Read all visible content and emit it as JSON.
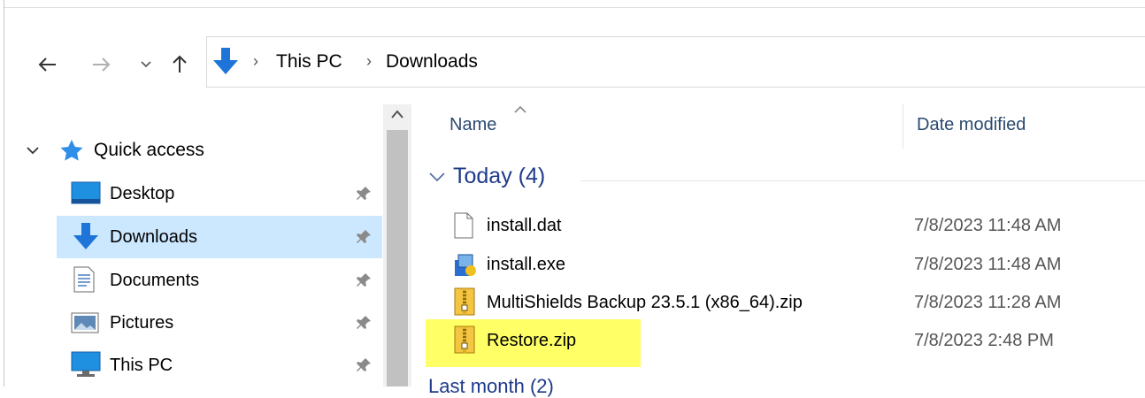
{
  "address": {
    "crumbs": [
      "This PC",
      "Downloads"
    ]
  },
  "nav": {
    "quick_access": "Quick access",
    "items": [
      {
        "label": "Desktop",
        "icon": "desktop-icon",
        "selected": false
      },
      {
        "label": "Downloads",
        "icon": "downloads-icon",
        "selected": true
      },
      {
        "label": "Documents",
        "icon": "documents-icon",
        "selected": false
      },
      {
        "label": "Pictures",
        "icon": "pictures-icon",
        "selected": false
      },
      {
        "label": "This PC",
        "icon": "this-pc-icon",
        "selected": false
      }
    ]
  },
  "columns": {
    "name": "Name",
    "date": "Date modified"
  },
  "group": {
    "label": "Today (4)",
    "next_label": "Last month (2)"
  },
  "files": [
    {
      "name": "install.dat",
      "date": "7/8/2023 11:48 AM",
      "icon": "file-icon"
    },
    {
      "name": "install.exe",
      "date": "7/8/2023 11:48 AM",
      "icon": "installer-icon"
    },
    {
      "name": "MultiShields Backup 23.5.1 (x86_64).zip",
      "date": "7/8/2023 11:28 AM",
      "icon": "zip-icon"
    },
    {
      "name": "Restore.zip",
      "date": "7/8/2023 2:48 PM",
      "icon": "zip-icon",
      "highlighted": true
    }
  ],
  "colors": {
    "selection": "#cce8ff",
    "highlight": "#ffff66",
    "accent_blue": "#1e74d8"
  }
}
